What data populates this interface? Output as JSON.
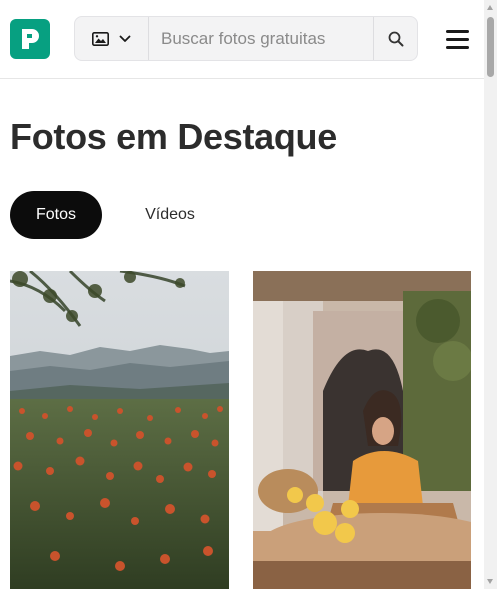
{
  "header": {
    "logo_letter": "P",
    "search": {
      "media_type_icon": "image-icon",
      "placeholder": "Buscar fotos gratuitas",
      "search_icon": "search-icon"
    },
    "menu_icon": "hamburger-menu-icon"
  },
  "main": {
    "title": "Fotos em Destaque",
    "tabs": [
      {
        "label": "Fotos",
        "active": true
      },
      {
        "label": "Vídeos",
        "active": false
      }
    ],
    "photos": [
      {
        "subject": "orange-flower-field-mountains"
      },
      {
        "subject": "woman-at-table-with-lemons"
      }
    ]
  },
  "colors": {
    "brand": "#07a081",
    "active_tab_bg": "#0c0c0c",
    "search_bg": "#f3f3f4"
  }
}
